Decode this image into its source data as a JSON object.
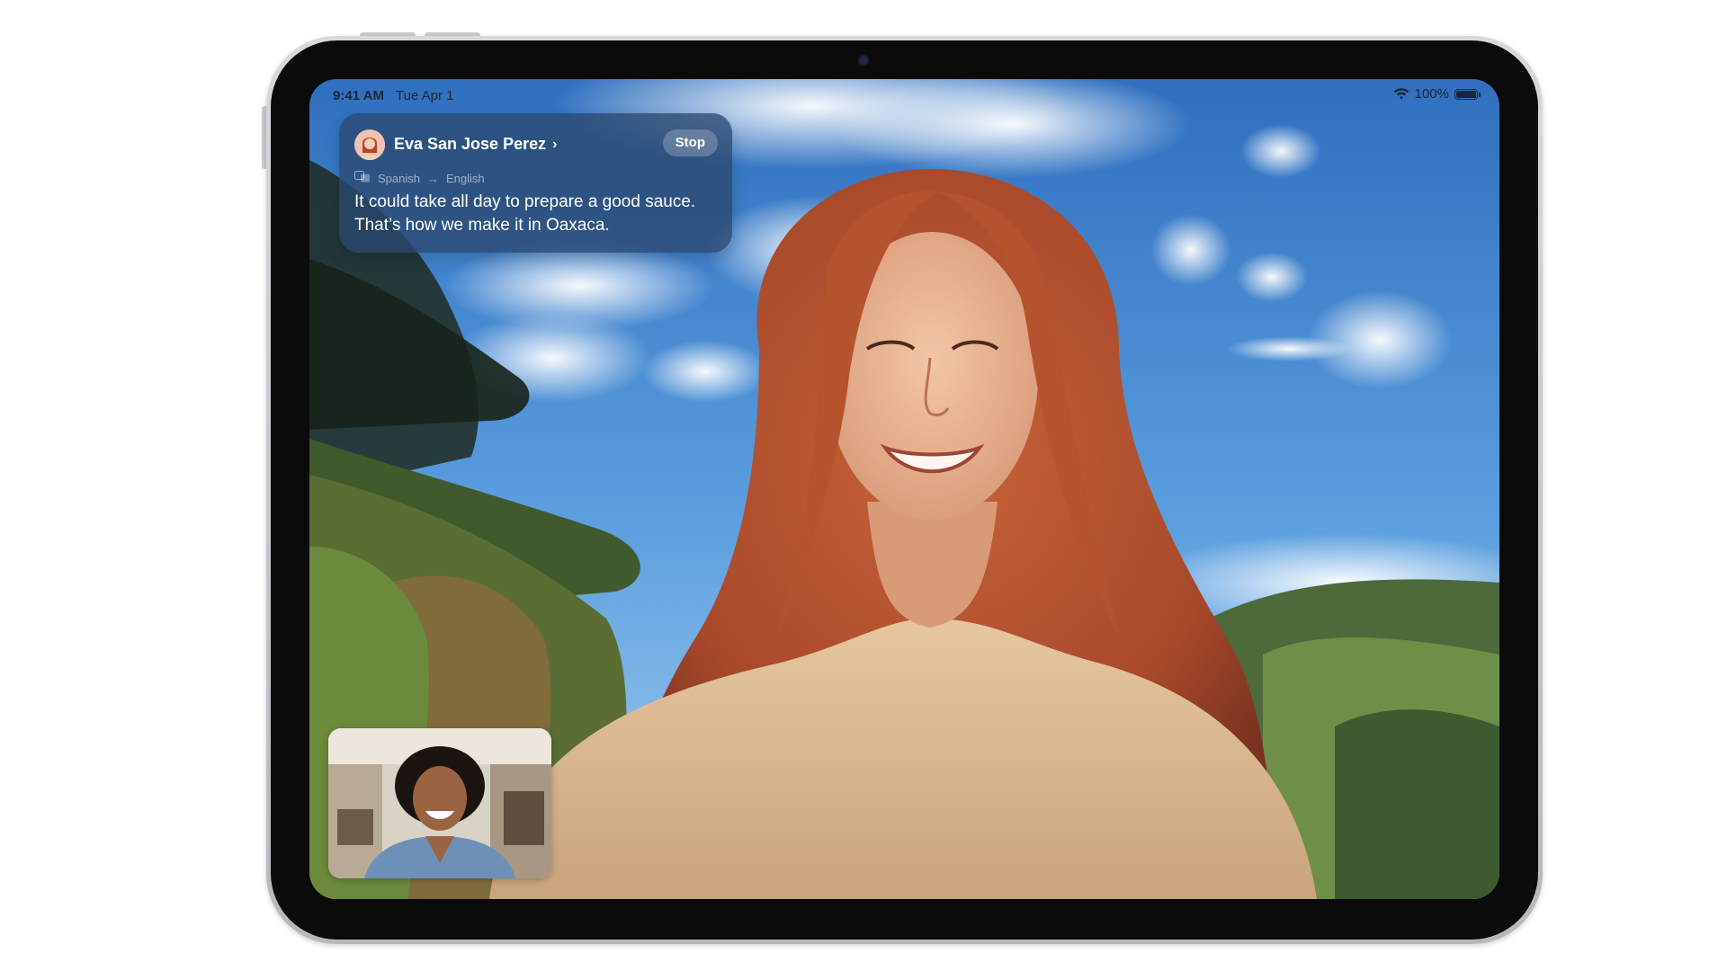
{
  "status_bar": {
    "time": "9:41 AM",
    "date": "Tue Apr 1",
    "battery_percent": "100%",
    "wifi_icon": "wifi-icon",
    "battery_icon": "battery-icon",
    "battery_level": 1.0
  },
  "translation": {
    "caller_name": "Eva San Jose Perez",
    "chevron_icon": "chevron-right-icon",
    "stop_label": "Stop",
    "translate_icon": "translate-icon",
    "source_language": "Spanish",
    "arrow": "→",
    "target_language": "English",
    "message": "It could take all day to prepare a good sauce. That’s how we make it in Oaxaca."
  },
  "colors": {
    "card_background": "#2a4870",
    "sky": "#4d8fd6",
    "device_frame": "#0b0b0c",
    "device_edge": "#c9cacd"
  }
}
